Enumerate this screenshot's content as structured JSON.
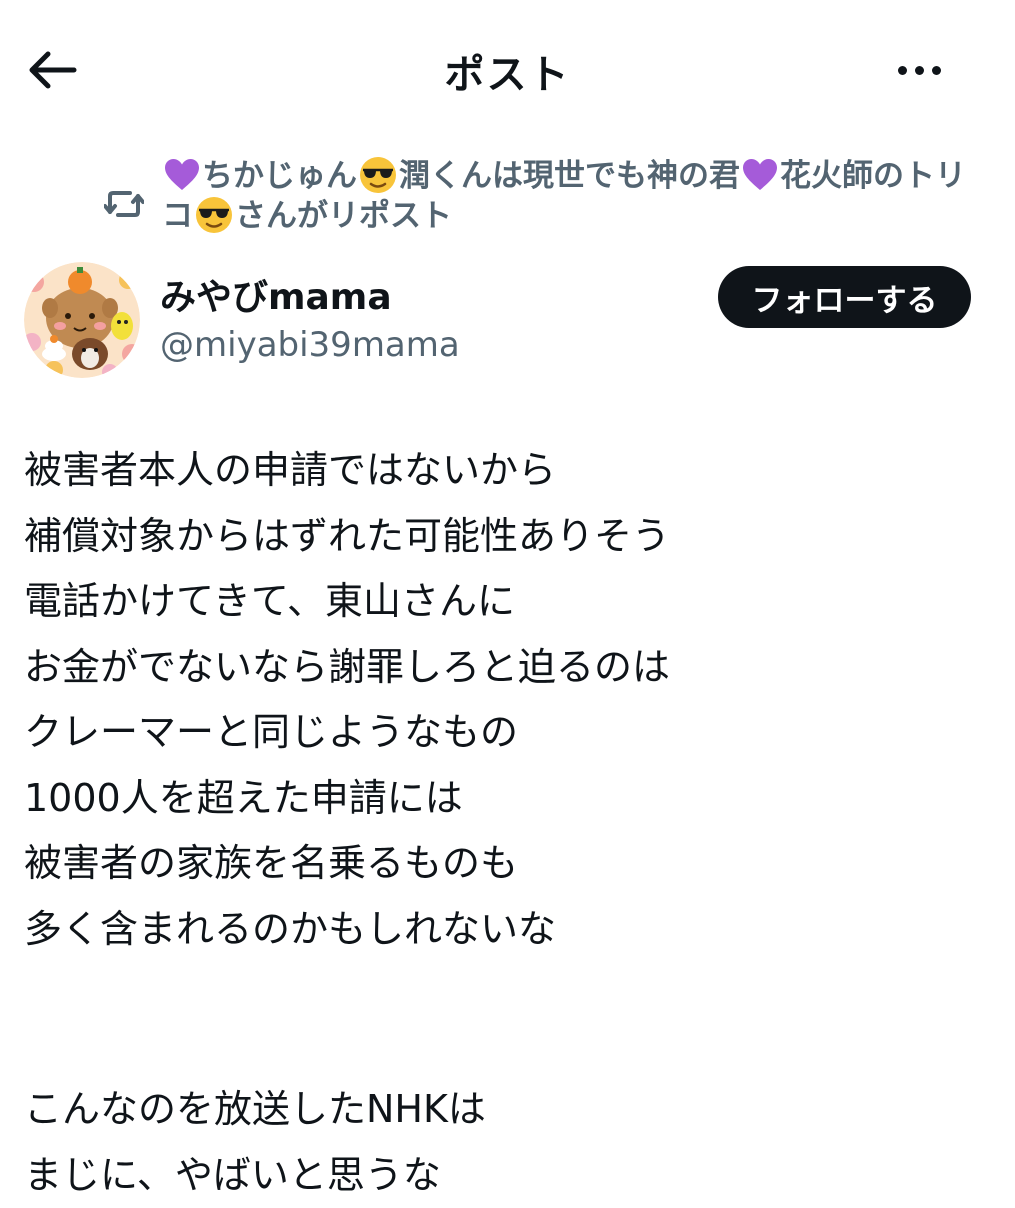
{
  "header": {
    "title": "ポスト",
    "back_icon": "arrow-left-icon",
    "more_icon": "more-horizontal-icon"
  },
  "repost": {
    "icon": "repost-icon",
    "part1": "ちかじゅん",
    "part2": "潤くんは現世でも神の君",
    "part3": "花火師のトリコ",
    "suffix": "さんがリポスト",
    "heart_color": "#a55bd9"
  },
  "author": {
    "name": "みやびmama",
    "handle": "@miyabi39mama",
    "follow_label": "フォローする"
  },
  "post": {
    "paragraph1": [
      "被害者本人の申請ではないから",
      "補償対象からはずれた可能性ありそう",
      "電話かけてきて、東山さんに",
      "お金がでないなら謝罪しろと迫るのは",
      "クレーマーと同じようなもの",
      "1000人を超えた申請には",
      "被害者の家族を名乗るものも",
      "多く含まれるのかもしれないな"
    ],
    "paragraph2": [
      "こんなのを放送したNHKは",
      "まじに、やばいと思うな"
    ]
  },
  "colors": {
    "text": "#0f1419",
    "secondary": "#536471",
    "button_bg": "#0f1419",
    "button_text": "#ffffff"
  }
}
